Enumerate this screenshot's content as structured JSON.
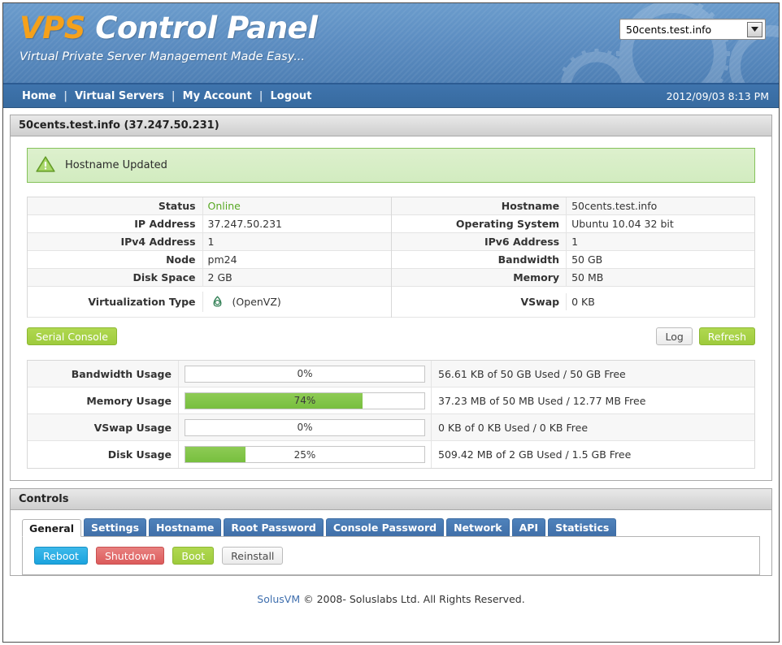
{
  "header": {
    "brand_vps": "VPS",
    "brand_rest": " Control Panel",
    "tagline": "Virtual Private Server Management Made Easy...",
    "server_select_value": "50cents.test.info",
    "accent_orange": "#f5a11b",
    "header_blue": "#5d8ec2"
  },
  "nav": {
    "items": [
      {
        "label": "Home"
      },
      {
        "label": "Virtual Servers"
      },
      {
        "label": "My Account"
      },
      {
        "label": "Logout"
      }
    ],
    "separator": "|",
    "datetime": "2012/09/03 8:13 PM"
  },
  "server_panel": {
    "title": "50cents.test.info (37.247.50.231)",
    "alert": {
      "icon": "warning-triangle-icon",
      "message": "Hostname Updated",
      "color": "#85c25a"
    },
    "info_left": [
      {
        "label": "Status",
        "value": "Online",
        "state": "online"
      },
      {
        "label": "IP Address",
        "value": "37.247.50.231"
      },
      {
        "label": "IPv4 Address",
        "value": "1"
      },
      {
        "label": "Node",
        "value": "pm24"
      },
      {
        "label": "Disk Space",
        "value": "2 GB"
      },
      {
        "label": "Virtualization Type",
        "value": "(OpenVZ)",
        "icon": "openvz-icon"
      }
    ],
    "info_right": [
      {
        "label": "Hostname",
        "value": "50cents.test.info"
      },
      {
        "label": "Operating System",
        "value": "Ubuntu 10.04 32 bit"
      },
      {
        "label": "IPv6 Address",
        "value": "1"
      },
      {
        "label": "Bandwidth",
        "value": "50 GB"
      },
      {
        "label": "Memory",
        "value": "50 MB"
      },
      {
        "label": "VSwap",
        "value": "0 KB"
      }
    ],
    "buttons": {
      "serial_console": "Serial Console",
      "log": "Log",
      "refresh": "Refresh"
    },
    "usage": [
      {
        "label": "Bandwidth Usage",
        "percent": 0,
        "percent_text": "0%",
        "detail": "56.61 KB of 50 GB Used / 50 GB Free"
      },
      {
        "label": "Memory Usage",
        "percent": 74,
        "percent_text": "74%",
        "detail": "37.23 MB of 50 MB Used / 12.77 MB Free"
      },
      {
        "label": "VSwap Usage",
        "percent": 0,
        "percent_text": "0%",
        "detail": "0 KB of 0 KB Used / 0 KB Free"
      },
      {
        "label": "Disk Usage",
        "percent": 25,
        "percent_text": "25%",
        "detail": "509.42 MB of 2 GB Used / 1.5 GB Free"
      }
    ]
  },
  "controls_panel": {
    "title": "Controls",
    "tabs": [
      {
        "label": "General",
        "active": true
      },
      {
        "label": "Settings",
        "active": false
      },
      {
        "label": "Hostname",
        "active": false
      },
      {
        "label": "Root Password",
        "active": false
      },
      {
        "label": "Console Password",
        "active": false
      },
      {
        "label": "Network",
        "active": false
      },
      {
        "label": "API",
        "active": false
      },
      {
        "label": "Statistics",
        "active": false
      }
    ],
    "actions": [
      {
        "label": "Reboot",
        "style": "blue",
        "color": "#1ba3de"
      },
      {
        "label": "Shutdown",
        "style": "red",
        "color": "#dc5b5b"
      },
      {
        "label": "Boot",
        "style": "green",
        "color": "#9ecb3c"
      },
      {
        "label": "Reinstall",
        "style": "grey",
        "color": "#ebebeb"
      }
    ]
  },
  "footer": {
    "link": "SolusVM",
    "text": " © 2008- Soluslabs Ltd. All Rights Reserved."
  }
}
